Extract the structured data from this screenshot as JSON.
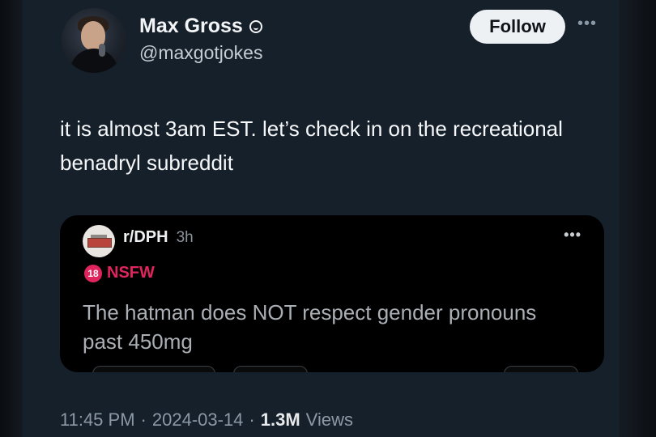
{
  "author": {
    "display_name": "Max Gross",
    "handle": "@maxgotjokes"
  },
  "header": {
    "follow_label": "Follow",
    "more_icon": "ellipsis-icon"
  },
  "tweet": {
    "text": "it is almost 3am EST. let’s check in on the recreational benadryl subreddit"
  },
  "quote": {
    "subreddit": "r/DPH",
    "age": "3h",
    "nsfw_badge": "18",
    "nsfw_label": "NSFW",
    "title": "The hatman does NOT respect gender pronouns past 450mg",
    "more_icon": "ellipsis-icon"
  },
  "meta": {
    "time": "11:45 PM",
    "separator": "·",
    "date": "2024-03-14",
    "views_count": "1.3M",
    "views_label": "Views"
  },
  "colors": {
    "background": "#16202a",
    "quote_background": "#000000",
    "nsfw": "#e0245e",
    "follow_button": "#eef1f4"
  }
}
